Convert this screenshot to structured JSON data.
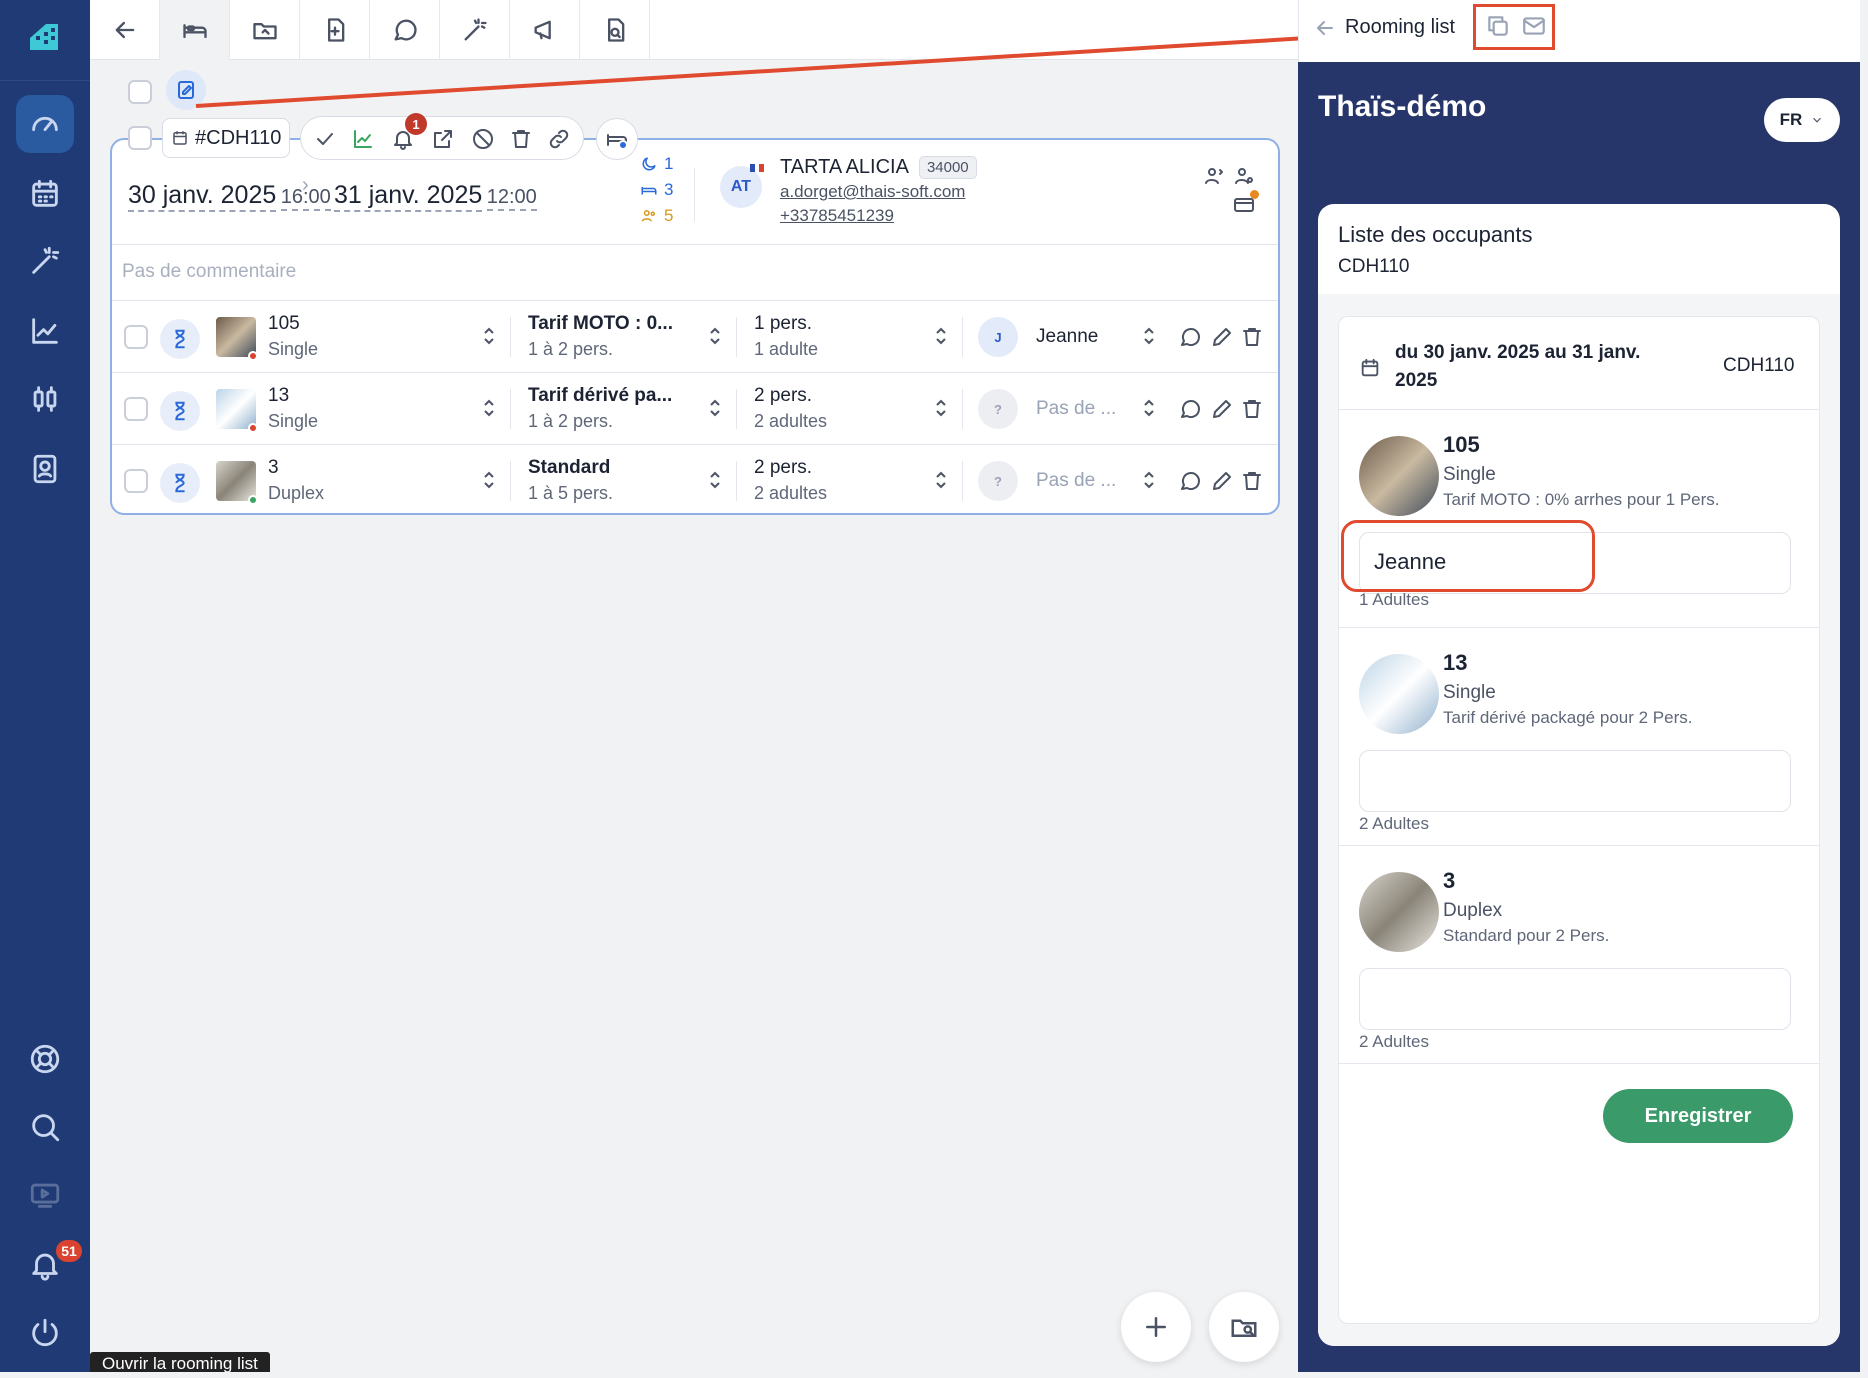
{
  "sidebar": {
    "notification_badge": "51",
    "items": [
      "dashboard-icon",
      "calendar-icon",
      "magic-wand-icon",
      "chart-icon",
      "sliders-icon",
      "contact-book-icon"
    ],
    "bottom_items": [
      "help-lifebuoy-icon",
      "search-icon",
      "video-icon",
      "bell-icon",
      "power-icon"
    ]
  },
  "toolbar": {
    "icons": [
      "back-arrow-icon",
      "bed-icon",
      "folder-icon",
      "file-import-icon",
      "chat-icon",
      "magic-wand-icon",
      "megaphone-icon",
      "file-search-icon"
    ]
  },
  "booking": {
    "ref": "#CDH110",
    "action_badge": "1",
    "arrival_date": "30 janv. 2025",
    "arrival_time": "16:00",
    "departure_date": "31 janv. 2025",
    "departure_time": "12:00",
    "nights": "1",
    "rooms": "3",
    "persons": "5",
    "client_initials": "AT",
    "client_name": "TARTA ALICIA",
    "client_code": "34000",
    "client_email": "a.dorget@thais-soft.com",
    "client_phone": "+33785451239",
    "comment_placeholder": "Pas de commentaire",
    "rows": [
      {
        "room": "105",
        "type": "Single",
        "rate": "Tarif MOTO : 0...",
        "rate_sub": "1 à 2 pers.",
        "pers": "1 pers.",
        "pers_sub": "1 adulte",
        "guest_initial": "J",
        "guest": "Jeanne",
        "status_color": "#d9432f"
      },
      {
        "room": "13",
        "type": "Single",
        "rate": "Tarif dérivé pa...",
        "rate_sub": "1 à 2 pers.",
        "pers": "2 pers.",
        "pers_sub": "2 adultes",
        "guest_initial": "?",
        "guest": "Pas de ...",
        "status_color": "#d9432f"
      },
      {
        "room": "3",
        "type": "Duplex",
        "rate": "Standard",
        "rate_sub": "1 à 5 pers.",
        "pers": "2 pers.",
        "pers_sub": "2 adultes",
        "guest_initial": "?",
        "guest": "Pas de ...",
        "status_color": "#3aa560"
      }
    ]
  },
  "tooltip": "Ouvrir la rooming list",
  "rooming": {
    "header_title": "Rooming list",
    "hotel_name": "Thaïs-démo",
    "language": "FR",
    "card_title": "Liste des occupants",
    "card_ref": "CDH110",
    "period": "du 30 janv. 2025 au 31 janv. 2025",
    "period_line1": "du 30 janv. 2025 au 31 janv.",
    "period_line2": "2025",
    "period_ref": "CDH110",
    "rooms": [
      {
        "number": "105",
        "type": "Single",
        "rate": "Tarif MOTO : 0% arrhes pour 1 Pers.",
        "occupant": "Jeanne",
        "adults": "1 Adultes"
      },
      {
        "number": "13",
        "type": "Single",
        "rate": "Tarif dérivé packagé pour 2 Pers.",
        "occupant": "",
        "adults": "2 Adultes"
      },
      {
        "number": "3",
        "type": "Duplex",
        "rate": "Standard pour 2 Pers.",
        "occupant": "",
        "adults": "2 Adultes"
      }
    ],
    "save_label": "Enregistrer"
  },
  "colors": {
    "sidebar": "#1f3a74",
    "panel": "#27366a",
    "accent": "#2a6ad8",
    "save": "#3a9a6a",
    "highlight": "#e04a2f"
  }
}
